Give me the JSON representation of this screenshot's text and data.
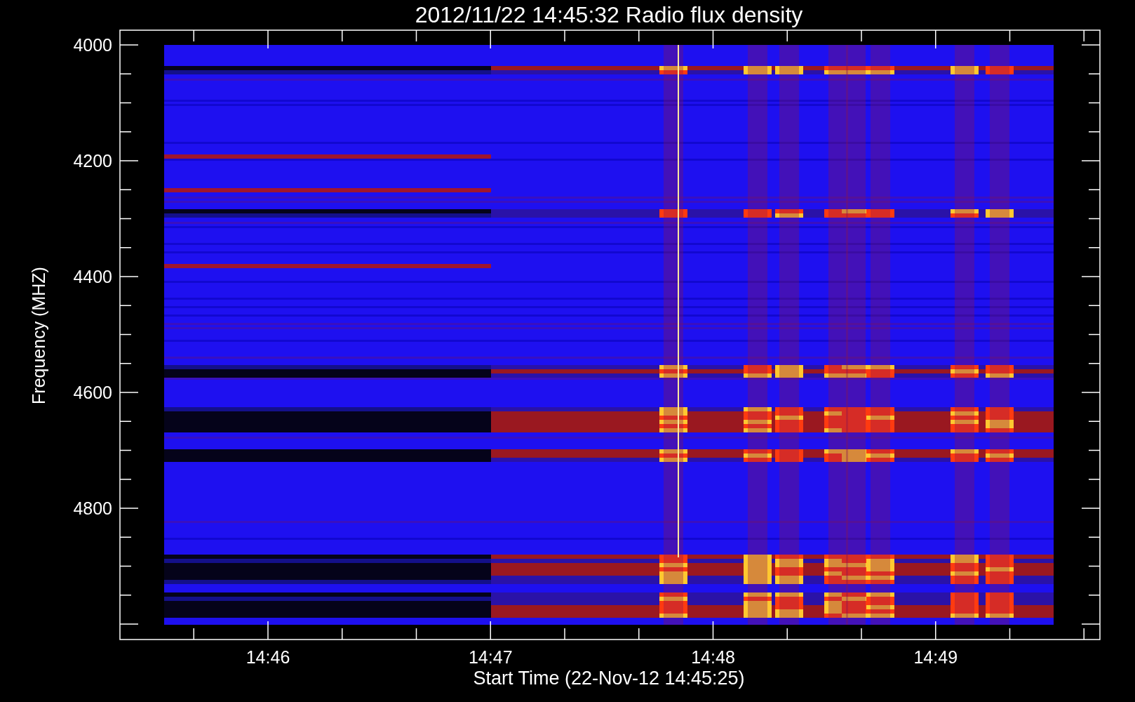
{
  "title": "2012/11/22 14:45:32 Radio flux density",
  "y_axis": {
    "label": "Frequency (MHZ)",
    "ticks": [
      "4000",
      "4200",
      "4400",
      "4600",
      "4800"
    ]
  },
  "x_axis": {
    "label": "Start Time (22-Nov-12 14:45:25)",
    "ticks": [
      "14:46",
      "14:47",
      "14:48",
      "14:49"
    ]
  }
}
